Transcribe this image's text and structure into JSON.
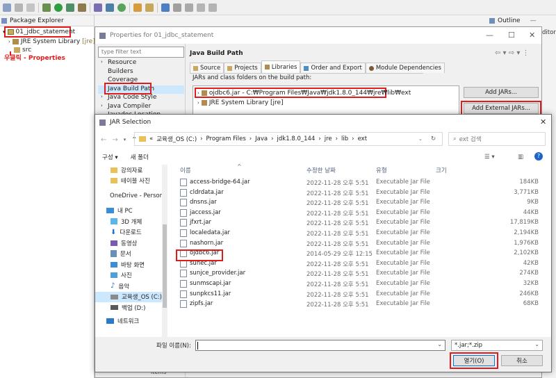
{
  "package_explorer": {
    "tab": "Package Explorer",
    "project": "01_jdbc_statement",
    "jre": "JRE System Library",
    "jre_tag": "[jre]",
    "src": "src",
    "annotation": "우클릭 - Properties"
  },
  "outline": {
    "tab": "Outline",
    "editor_stub": "ditor"
  },
  "properties": {
    "title": "Properties for 01_jdbc_statement",
    "filter_placeholder": "type filter text",
    "tree": [
      "Resource",
      "Builders",
      "Coverage",
      "Java Build Path",
      "Java Code Style",
      "Java Compiler",
      "Javadoc Location"
    ],
    "heading": "Java Build Path",
    "tabs": [
      "Source",
      "Projects",
      "Libraries",
      "Order and Export",
      "Module Dependencies"
    ],
    "jars_label": "JARs and class folders on the build path:",
    "entries": [
      "ojdbc6.jar - C:₩Program Files₩Java₩jdk1.8.0_144₩jre₩lib₩ext",
      "JRE System Library [jre]"
    ],
    "buttons": [
      "Add JARs...",
      "Add External JARs..."
    ],
    "bottom_stub": "ltems"
  },
  "jar_dialog": {
    "title": "JAR Selection",
    "path": [
      "«",
      "교육생_OS (C:)",
      "Program Files",
      "Java",
      "jdk1.8.0_144",
      "jre",
      "lib",
      "ext"
    ],
    "search_placeholder": "ext 검색",
    "organize": "구성 ▾",
    "new_folder": "새 폴더",
    "nav": [
      "강의자료",
      "테이블 사진",
      "OneDrive - Person",
      "내 PC",
      "3D 개체",
      "다운로드",
      "동영상",
      "문서",
      "바탕 화면",
      "사진",
      "음악",
      "교육생_OS (C:)",
      "백업 (D:)",
      "네트워크"
    ],
    "columns": [
      "이름",
      "수정한 날짜",
      "유형",
      "크기"
    ],
    "files": [
      {
        "name": "access-bridge-64.jar",
        "date": "2022-11-28 오후 5:51",
        "type": "Executable Jar File",
        "size": "184KB"
      },
      {
        "name": "cldrdata.jar",
        "date": "2022-11-28 오후 5:51",
        "type": "Executable Jar File",
        "size": "3,771KB"
      },
      {
        "name": "dnsns.jar",
        "date": "2022-11-28 오후 5:51",
        "type": "Executable Jar File",
        "size": "9KB"
      },
      {
        "name": "jaccess.jar",
        "date": "2022-11-28 오후 5:51",
        "type": "Executable Jar File",
        "size": "44KB"
      },
      {
        "name": "jfxrt.jar",
        "date": "2022-11-28 오후 5:51",
        "type": "Executable Jar File",
        "size": "17,819KB"
      },
      {
        "name": "localedata.jar",
        "date": "2022-11-28 오후 5:51",
        "type": "Executable Jar File",
        "size": "2,194KB"
      },
      {
        "name": "nashorn.jar",
        "date": "2022-11-28 오후 5:51",
        "type": "Executable Jar File",
        "size": "1,976KB"
      },
      {
        "name": "ojdbc6.jar",
        "date": "2014-05-29 오후 12:15",
        "type": "Executable Jar File",
        "size": "2,102KB"
      },
      {
        "name": "sunec.jar",
        "date": "2022-11-28 오후 5:51",
        "type": "Executable Jar File",
        "size": "42KB"
      },
      {
        "name": "sunjce_provider.jar",
        "date": "2022-11-28 오후 5:51",
        "type": "Executable Jar File",
        "size": "274KB"
      },
      {
        "name": "sunmscapi.jar",
        "date": "2022-11-28 오후 5:51",
        "type": "Executable Jar File",
        "size": "32KB"
      },
      {
        "name": "sunpkcs11.jar",
        "date": "2022-11-28 오후 5:51",
        "type": "Executable Jar File",
        "size": "246KB"
      },
      {
        "name": "zipfs.jar",
        "date": "2022-11-28 오후 5:51",
        "type": "Executable Jar File",
        "size": "68KB"
      }
    ],
    "filename_label": "파일 이름(N):",
    "filename_value": "",
    "filter_value": "*.jar;*.zip",
    "open": "열기(O)",
    "cancel": "취소"
  }
}
